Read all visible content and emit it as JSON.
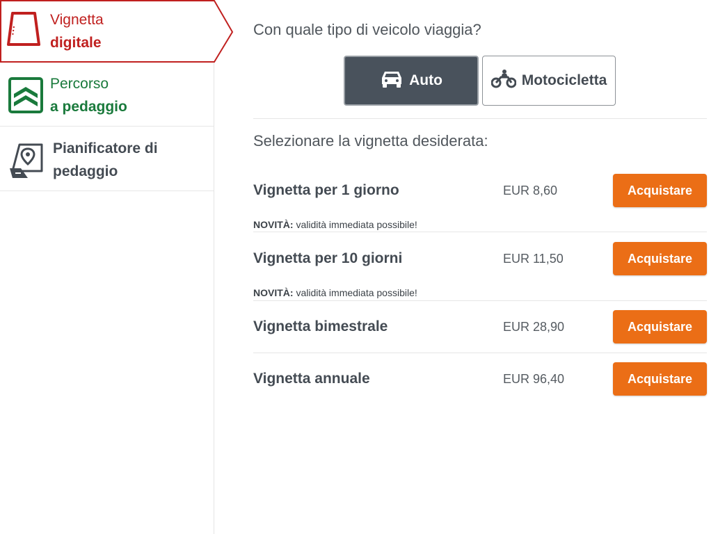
{
  "sidebar": {
    "items": [
      {
        "line1": "Vignetta",
        "line2": "digitale",
        "icon": "windshield-vignette-icon",
        "color": "#c0201f",
        "active": true
      },
      {
        "line1": "Percorso",
        "line2": "a pedaggio",
        "icon": "toll-road-icon",
        "color": "#1a7a3c",
        "active": false
      },
      {
        "line1": "Pianificatore di",
        "line2": "pedaggio",
        "icon": "map-pin-road-icon",
        "color": "#444b53",
        "active": false
      }
    ]
  },
  "vehicle": {
    "question": "Con quale tipo di veicolo viaggia?",
    "options": [
      {
        "label": "Auto",
        "icon": "car-icon",
        "selected": true
      },
      {
        "label": "Motocicletta",
        "icon": "motorcycle-icon",
        "selected": false
      }
    ]
  },
  "select_label": "Selezionare la vignetta desiderata:",
  "products": [
    {
      "name": "Vignetta per 1 giorno",
      "price": "EUR 8,60",
      "button": "Acquistare",
      "note_bold": "NOVITÀ:",
      "note": " validità immediata possibile!"
    },
    {
      "name": "Vignetta per 10 giorni",
      "price": "EUR 11,50",
      "button": "Acquistare",
      "note_bold": "NOVITÀ:",
      "note": " validità immediata possibile!"
    },
    {
      "name": "Vignetta bimestrale",
      "price": "EUR 28,90",
      "button": "Acquistare"
    },
    {
      "name": "Vignetta annuale",
      "price": "EUR 96,40",
      "button": "Acquistare"
    }
  ],
  "colors": {
    "accent": "#eb6e16",
    "active_red": "#c0201f",
    "green": "#1a7a3c",
    "selected_dark": "#49525c"
  }
}
